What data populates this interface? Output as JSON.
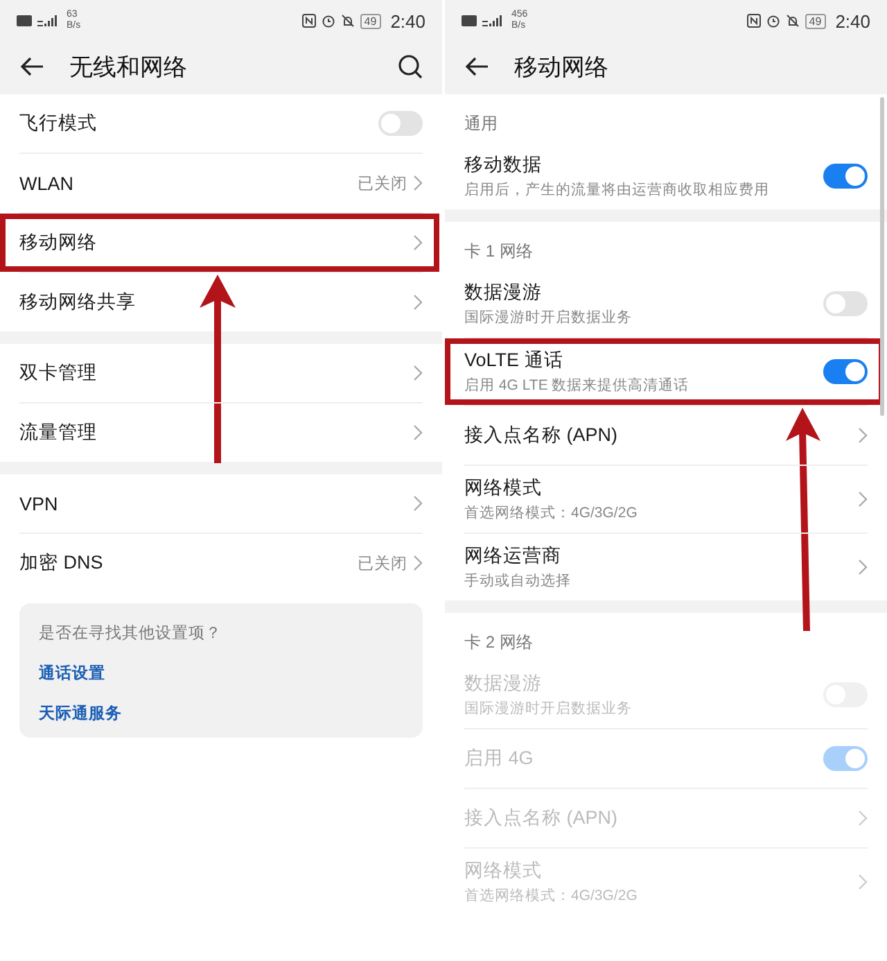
{
  "screens": [
    {
      "status_bar": {
        "speed": "63",
        "speed_unit": "B/s",
        "battery": "49",
        "time": "2:40"
      },
      "header": {
        "title": "无线和网络",
        "search": true
      },
      "scrollbar": false,
      "groups": [
        {
          "items": [
            {
              "kind": "toggle",
              "title": "飞行模式",
              "on": false,
              "disabled": false,
              "highlighted": false
            },
            {
              "kind": "link",
              "title": "WLAN",
              "value": "已关闭",
              "disabled": false,
              "highlighted": false
            },
            {
              "kind": "link",
              "title": "移动网络",
              "disabled": false,
              "highlighted": true
            },
            {
              "kind": "link",
              "title": "移动网络共享",
              "disabled": false,
              "highlighted": false
            }
          ]
        },
        {
          "items": [
            {
              "kind": "link",
              "title": "双卡管理",
              "disabled": false,
              "highlighted": false
            },
            {
              "kind": "link",
              "title": "流量管理",
              "disabled": false,
              "highlighted": false
            }
          ]
        },
        {
          "items": [
            {
              "kind": "link",
              "title": "VPN",
              "disabled": false,
              "highlighted": false
            },
            {
              "kind": "link",
              "title": "加密 DNS",
              "value": "已关闭",
              "disabled": false,
              "highlighted": false
            }
          ]
        }
      ],
      "suggestion": {
        "question": "是否在寻找其他设置项？",
        "links": [
          "通话设置",
          "天际通服务"
        ]
      }
    },
    {
      "status_bar": {
        "speed": "456",
        "speed_unit": "B/s",
        "battery": "49",
        "time": "2:40"
      },
      "header": {
        "title": "移动网络",
        "search": false
      },
      "scrollbar": true,
      "groups": [
        {
          "header": "通用",
          "items": [
            {
              "kind": "toggle",
              "title": "移动数据",
              "subtitle": "启用后，产生的流量将由运营商收取相应费用",
              "on": true,
              "disabled": false,
              "highlighted": false
            }
          ]
        },
        {
          "header": "卡 1 网络",
          "items": [
            {
              "kind": "toggle",
              "title": "数据漫游",
              "subtitle": "国际漫游时开启数据业务",
              "on": false,
              "disabled": false,
              "highlighted": false
            },
            {
              "kind": "toggle",
              "title": "VoLTE 通话",
              "subtitle": "启用 4G LTE 数据来提供高清通话",
              "on": true,
              "disabled": false,
              "highlighted": true
            },
            {
              "kind": "link",
              "title": "接入点名称 (APN)",
              "disabled": false,
              "highlighted": false
            },
            {
              "kind": "link",
              "title": "网络模式",
              "subtitle": "首选网络模式：4G/3G/2G",
              "disabled": false,
              "highlighted": false
            },
            {
              "kind": "link",
              "title": "网络运营商",
              "subtitle": "手动或自动选择",
              "disabled": false,
              "highlighted": false
            }
          ]
        },
        {
          "header": "卡 2 网络",
          "items": [
            {
              "kind": "toggle",
              "title": "数据漫游",
              "subtitle": "国际漫游时开启数据业务",
              "on": false,
              "disabled": true,
              "highlighted": false
            },
            {
              "kind": "toggle",
              "title": "启用 4G",
              "on": true,
              "disabled": true,
              "highlighted": false
            },
            {
              "kind": "link",
              "title": "接入点名称 (APN)",
              "disabled": true,
              "highlighted": false
            },
            {
              "kind": "link",
              "title": "网络模式",
              "subtitle": "首选网络模式：4G/3G/2G",
              "disabled": true,
              "highlighted": false
            }
          ]
        }
      ]
    }
  ]
}
